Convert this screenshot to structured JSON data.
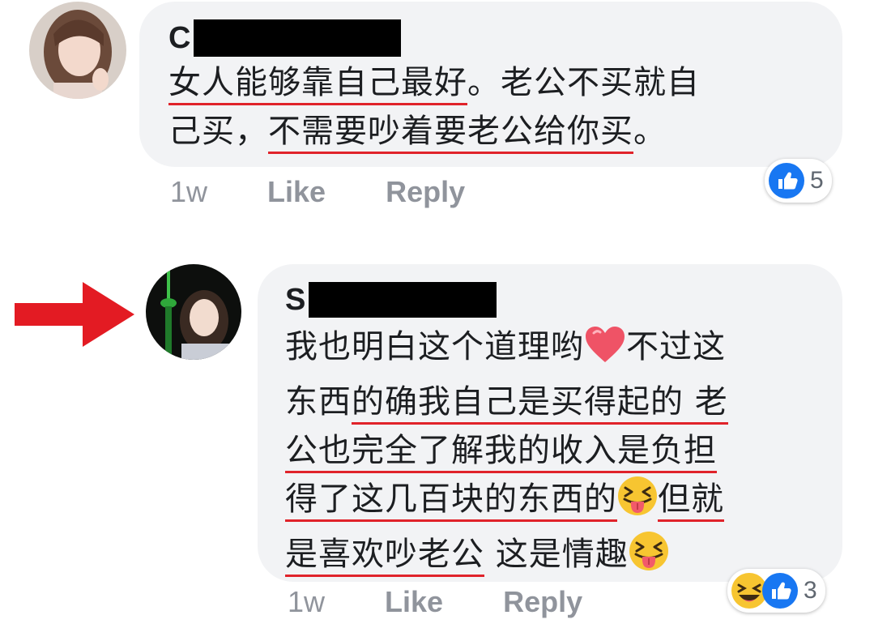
{
  "comments": [
    {
      "author_initial": "C",
      "lines": [
        [
          {
            "t": "女人能够靠自己最好",
            "u": true
          },
          {
            "t": "。老公不买就自",
            "u": false
          }
        ],
        [
          {
            "t": "己买，",
            "u": false
          },
          {
            "t": "不需要吵着要老公给你买",
            "u": true
          },
          {
            "t": "。",
            "u": false
          }
        ]
      ],
      "timestamp": "1w",
      "like_label": "Like",
      "reply_label": "Reply",
      "reactions": [
        "like"
      ],
      "reaction_count": "5"
    },
    {
      "author_initial": "S",
      "lines": [
        [
          {
            "t": "我也明白这个道理哟",
            "u": false
          },
          {
            "emoji": "heart"
          },
          {
            "t": "不过这",
            "u": false
          }
        ],
        [
          {
            "t": "东西",
            "u": false
          },
          {
            "t": "的确我自己是买得起的 老",
            "u": true
          }
        ],
        [
          {
            "t": "公也完全了解我的收入是负担",
            "u": true
          }
        ],
        [
          {
            "t": "得了这几百块的东西的",
            "u": true
          },
          {
            "emoji": "tongue"
          },
          {
            "t": "但就",
            "u": true
          }
        ],
        [
          {
            "t": "是喜欢吵老公",
            "u": true
          },
          {
            "t": " 这是情趣",
            "u": false
          },
          {
            "emoji": "tongue"
          }
        ]
      ],
      "timestamp": "1w",
      "like_label": "Like",
      "reply_label": "Reply",
      "reactions": [
        "haha",
        "like"
      ],
      "reaction_count": "3"
    }
  ],
  "colors": {
    "bubble": "#f2f3f5",
    "underline": "#e0232a",
    "arrow": "#e31b23",
    "like_blue": "#1877f2",
    "meta_text": "#90949c"
  },
  "icons": {
    "arrow": "red-arrow-icon",
    "like": "like-thumb-icon",
    "haha": "haha-emoji-icon",
    "heart": "red-heart-emoji",
    "tongue": "squinting-tongue-emoji"
  }
}
